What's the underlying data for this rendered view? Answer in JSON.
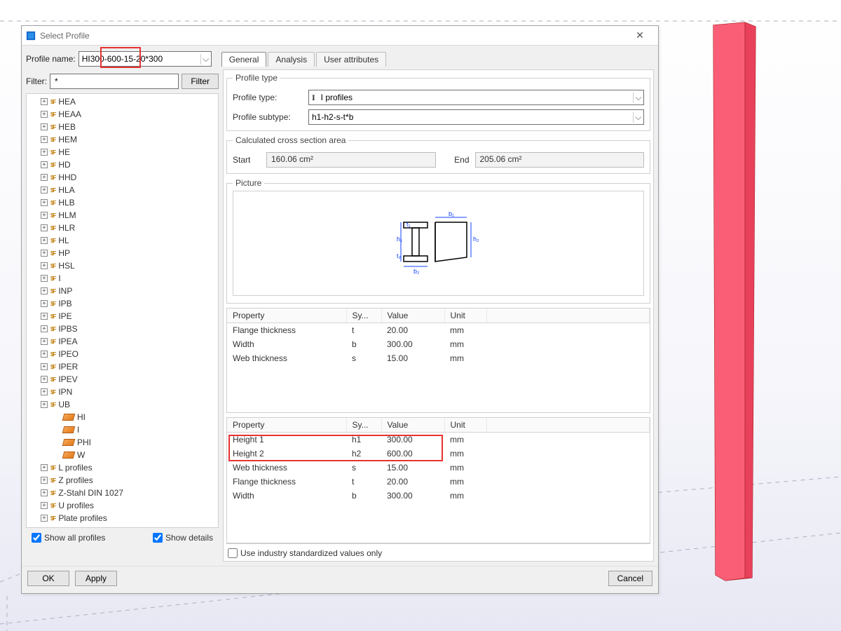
{
  "dialog": {
    "title": "Select Profile",
    "profile_name_label": "Profile name:",
    "profile_name_value": "HI300-600-15-20*300",
    "filter_label": "Filter:",
    "filter_value": "*",
    "filter_button": "Filter",
    "show_all": "Show all profiles",
    "show_details": "Show details",
    "use_industry": "Use industry standardized values only",
    "ok": "OK",
    "apply": "Apply",
    "cancel": "Cancel",
    "close_glyph": "✕"
  },
  "tabs": {
    "general": "General",
    "analysis": "Analysis",
    "user_attributes": "User attributes"
  },
  "profile_type": {
    "legend": "Profile type",
    "type_label": "Profile type:",
    "type_value": "I profiles",
    "subtype_label": "Profile subtype:",
    "subtype_value": "h1-h2-s-t*b"
  },
  "cross_section": {
    "legend": "Calculated cross section area",
    "start_label": "Start",
    "start_value": "160.06 cm²",
    "end_label": "End",
    "end_value": "205.06 cm²"
  },
  "picture_legend": "Picture",
  "picture_labels": {
    "b1": "b₁",
    "t1": "t₁",
    "h1": "h₁",
    "t2": "t₂",
    "b2": "b₂",
    "h2": "h₂"
  },
  "grid_headers": {
    "property": "Property",
    "sy": "Sy...",
    "value": "Value",
    "unit": "Unit"
  },
  "grid1": [
    {
      "property": "Flange thickness",
      "sy": "t",
      "value": "20.00",
      "unit": "mm"
    },
    {
      "property": "Width",
      "sy": "b",
      "value": "300.00",
      "unit": "mm"
    },
    {
      "property": "Web thickness",
      "sy": "s",
      "value": "15.00",
      "unit": "mm"
    }
  ],
  "grid2": [
    {
      "property": "Height 1",
      "sy": "h1",
      "value": "300.00",
      "unit": "mm"
    },
    {
      "property": "Height 2",
      "sy": "h2",
      "value": "600.00",
      "unit": "mm"
    },
    {
      "property": "Web thickness",
      "sy": "s",
      "value": "15.00",
      "unit": "mm"
    },
    {
      "property": "Flange thickness",
      "sy": "t",
      "value": "20.00",
      "unit": "mm"
    },
    {
      "property": "Width",
      "sy": "b",
      "value": "300.00",
      "unit": "mm"
    }
  ],
  "tree": {
    "branches": [
      "HEA",
      "HEAA",
      "HEB",
      "HEM",
      "HE",
      "HD",
      "HHD",
      "HLA",
      "HLB",
      "HLM",
      "HLR",
      "HL",
      "HP",
      "HSL",
      "I",
      "INP",
      "IPB",
      "IPE",
      "IPBS",
      "IPEA",
      "IPEO",
      "IPER",
      "IPEV",
      "IPN",
      "UB"
    ],
    "leaves": [
      "HI",
      "I",
      "PHI",
      "W"
    ],
    "roots": [
      "L profiles",
      "Z profiles",
      "Z-Stahl DIN 1027",
      "U profiles",
      "Plate profiles"
    ]
  }
}
